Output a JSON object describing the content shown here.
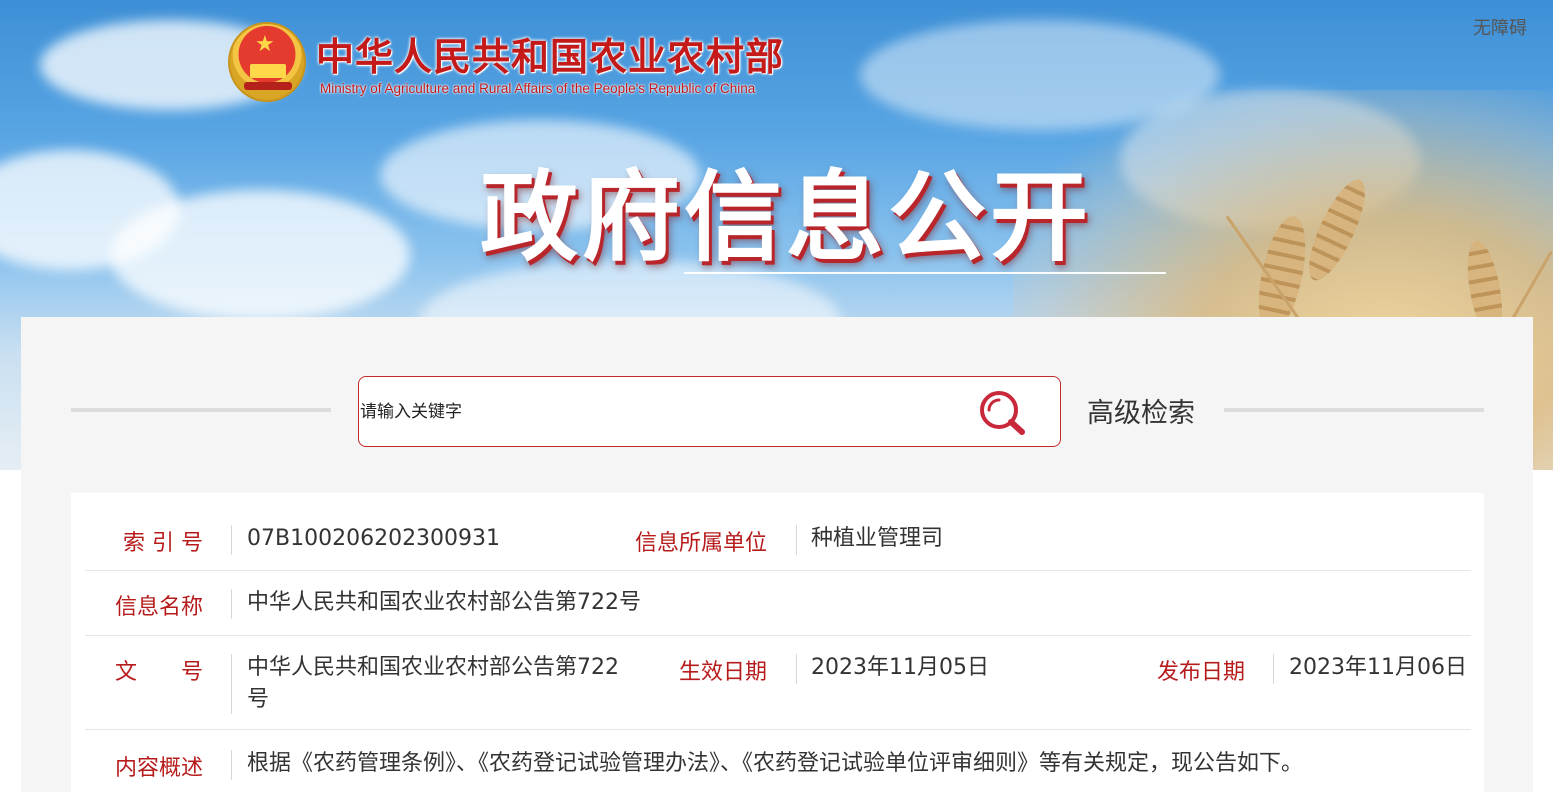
{
  "header": {
    "ministry_cn": "中华人民共和国农业农村部",
    "ministry_en": "Ministry of Agriculture and Rural Affairs of the People's Republic of China",
    "hero_title": "政府信息公开",
    "accessibility": "无障碍"
  },
  "search": {
    "placeholder": "请输入关键字",
    "advanced_label": "高级检索"
  },
  "info": {
    "index_no": {
      "label": "索 引 号",
      "value": "07B100206202300931"
    },
    "owner": {
      "label": "信息所属单位",
      "value": "种植业管理司"
    },
    "name": {
      "label": "信息名称",
      "value": "中华人民共和国农业农村部公告第722号"
    },
    "doc_no": {
      "label": "文　　号",
      "value": "中华人民共和国农业农村部公告第722号"
    },
    "effective": {
      "label": "生效日期",
      "value": "2023年11月05日"
    },
    "published": {
      "label": "发布日期",
      "value": "2023年11月06日"
    },
    "summary": {
      "label": "内容概述",
      "value": "根据《农药管理条例》、《农药登记试验管理办法》、《农药登记试验单位评审细则》等有关规定，现公告如下。"
    }
  },
  "colors": {
    "brand_red": "#c41a1a",
    "label_red": "#b71c1c",
    "sky_blue": "#3d8fd6"
  },
  "icons": [
    "emblem-icon",
    "search-icon"
  ]
}
